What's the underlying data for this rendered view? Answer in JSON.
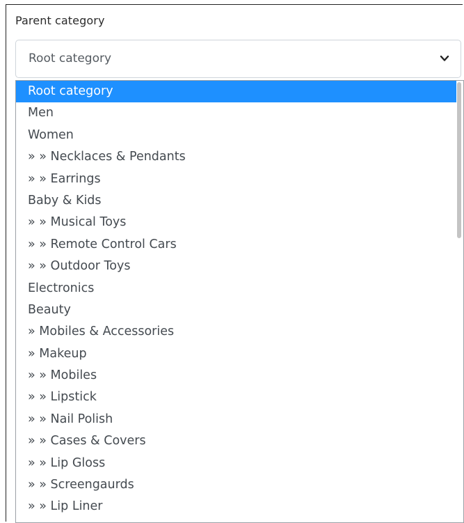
{
  "field": {
    "label": "Parent category",
    "selected_value": "Root category"
  },
  "icons": {
    "dropdown": "chevron-down-icon"
  },
  "colors": {
    "selected_bg": "#1e90ff",
    "selected_text": "#ffffff",
    "option_text": "#444a50"
  },
  "dropdown": {
    "options": [
      {
        "label": "Root category",
        "selected": true
      },
      {
        "label": "Men"
      },
      {
        "label": "Women"
      },
      {
        "label": "» » Necklaces & Pendants"
      },
      {
        "label": "» » Earrings"
      },
      {
        "label": "Baby & Kids"
      },
      {
        "label": "» » Musical Toys"
      },
      {
        "label": "» » Remote Control Cars"
      },
      {
        "label": "» » Outdoor Toys"
      },
      {
        "label": "Electronics"
      },
      {
        "label": "Beauty"
      },
      {
        "label": "» Mobiles & Accessories"
      },
      {
        "label": "» Makeup"
      },
      {
        "label": "» » Mobiles"
      },
      {
        "label": "» » Lipstick"
      },
      {
        "label": "» » Nail Polish"
      },
      {
        "label": "» » Cases & Covers"
      },
      {
        "label": "» » Lip Gloss"
      },
      {
        "label": "» » Screengaurds"
      },
      {
        "label": "» » Lip Liner"
      }
    ]
  }
}
